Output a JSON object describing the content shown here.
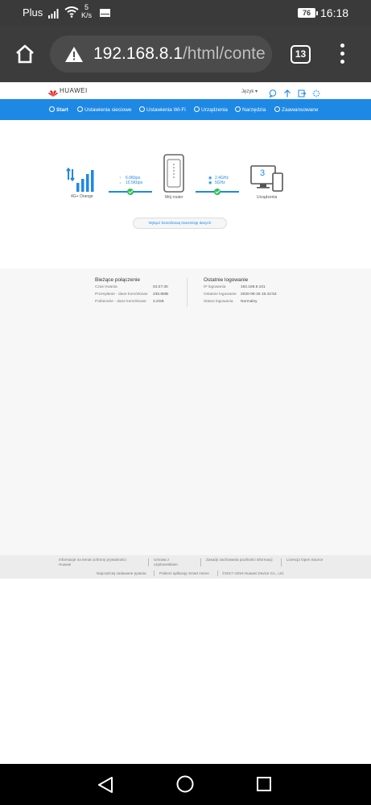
{
  "status_bar": {
    "carrier": "Plus",
    "speed_value": "5",
    "speed_unit": "K/s",
    "battery": "76",
    "time": "16:18"
  },
  "browser": {
    "url_host": "192.168.8.1",
    "url_path": "/html/conte",
    "tab_count": "13",
    "icons": [
      "home-icon",
      "warning-icon",
      "tabs-icon",
      "overflow-menu-icon"
    ]
  },
  "router_header": {
    "brand": "HUAWEI",
    "language": "Język",
    "icons": [
      "chat-icon",
      "upload-icon",
      "update-icon",
      "logout-icon",
      "loading-icon"
    ]
  },
  "nav": {
    "items": [
      {
        "label": "Start",
        "icon": "home-icon"
      },
      {
        "label": "Ustawienia sieciowe",
        "icon": "globe-icon"
      },
      {
        "label": "Ustawienia Wi-Fi",
        "icon": "wifi-icon"
      },
      {
        "label": "Urządzenia",
        "icon": "devices-icon"
      },
      {
        "label": "Narzędzia",
        "icon": "tools-icon"
      },
      {
        "label": "Zaawansowane",
        "icon": "gear-icon"
      }
    ]
  },
  "topology": {
    "network_label": "4G+ Orange",
    "upload_speed": "6.0Kbps",
    "download_speed": "10.5Kbps",
    "router_label": "Mój router",
    "wifi_band_1": "2.4GHz",
    "wifi_band_2": "5GHz",
    "devices_count": "3",
    "devices_label": "Urządzenia",
    "toggle_button": "Wyłącz komórkową transmisję danych"
  },
  "current_connection": {
    "title": "Bieżące połączenie",
    "rows": [
      {
        "key": "Czas trwania",
        "value": "04:27:30"
      },
      {
        "key": "Przesyłanie - dane komórkowe",
        "value": "235.8MB"
      },
      {
        "key": "Pobieranie - dane komórkowe",
        "value": "3.2GB"
      }
    ]
  },
  "last_login": {
    "title": "Ostatnie logowanie",
    "rows": [
      {
        "key": "IP logowania",
        "value": "192.168.8.101"
      },
      {
        "key": "Ostatnie logowanie",
        "value": "2020-06-26 15:42:53"
      },
      {
        "key": "Status logowania",
        "value": "Normalny"
      }
    ]
  },
  "footer": {
    "privacy": "Informacje na temat ochrony prywatności Huawei",
    "user_agreement": "Umowa z użytkownikiem",
    "privacy_rules": "Zasady zachowania poufności informacji",
    "open_source": "Licencja Open Source",
    "faq": "Najczęściej zadawane pytania",
    "smart_home": "Pobierz aplikację Smart Home",
    "copyright": "©2017~2019 Huawei Device Co., Ltd."
  },
  "colors": {
    "accent_blue": "#1e88e5",
    "ok_green": "#2fbf55",
    "huawei_red": "#e0201b",
    "status_bar_bg": "#3a3a3a",
    "browser_bar_bg": "#3c3c3c"
  },
  "system_nav": {
    "icons": [
      "back-icon",
      "home-circle-icon",
      "recents-icon"
    ]
  }
}
